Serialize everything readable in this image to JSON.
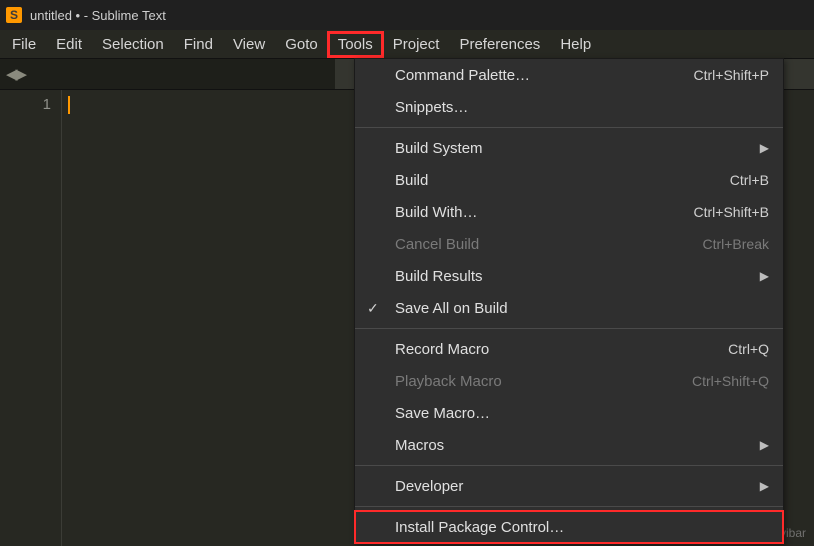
{
  "title": "untitled • - Sublime Text",
  "app_icon_letter": "S",
  "menubar": [
    "File",
    "Edit",
    "Selection",
    "Find",
    "View",
    "Goto",
    "Tools",
    "Project",
    "Preferences",
    "Help"
  ],
  "highlight_menu_index": 6,
  "gutter_line": "1",
  "tools_menu": {
    "command_palette": {
      "label": "Command Palette…",
      "shortcut": "Ctrl+Shift+P"
    },
    "snippets": {
      "label": "Snippets…"
    },
    "build_system": {
      "label": "Build System"
    },
    "build": {
      "label": "Build",
      "shortcut": "Ctrl+B"
    },
    "build_with": {
      "label": "Build With…",
      "shortcut": "Ctrl+Shift+B"
    },
    "cancel_build": {
      "label": "Cancel Build",
      "shortcut": "Ctrl+Break"
    },
    "build_results": {
      "label": "Build Results"
    },
    "save_all_on_build": {
      "label": "Save All on Build"
    },
    "record_macro": {
      "label": "Record Macro",
      "shortcut": "Ctrl+Q"
    },
    "playback_macro": {
      "label": "Playback Macro",
      "shortcut": "Ctrl+Shift+Q"
    },
    "save_macro": {
      "label": "Save Macro…"
    },
    "macros": {
      "label": "Macros"
    },
    "developer": {
      "label": "Developer"
    },
    "install_pkg": {
      "label": "Install Package Control…"
    }
  },
  "watermark": "CSDN @Xiaoyibar"
}
